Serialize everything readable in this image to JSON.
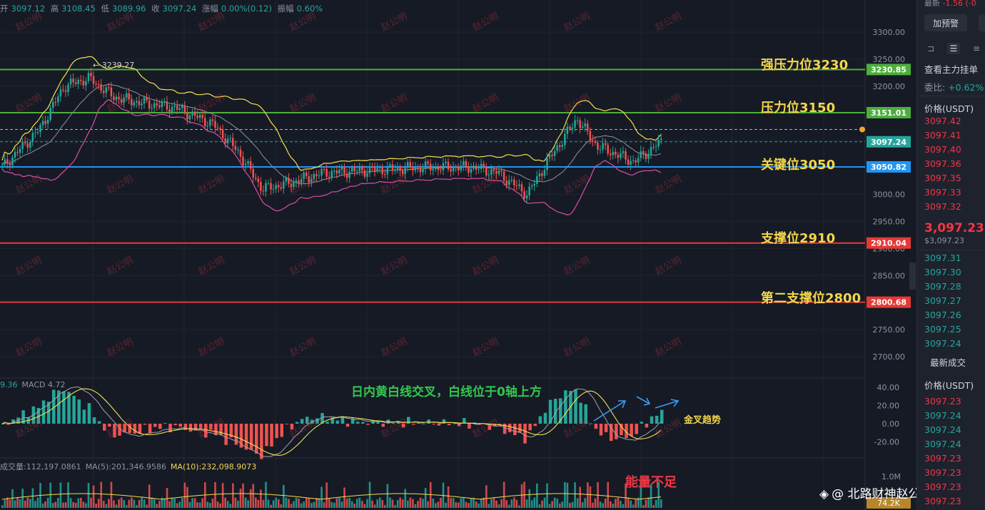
{
  "ohlc_bar": {
    "open_label": "开",
    "open": "3097.12",
    "high_label": "高",
    "high": "3108.45",
    "low_label": "低",
    "low": "3089.96",
    "close_label": "收",
    "close": "3097.24",
    "change_label": "涨幅",
    "change": "0.00%(0.12)",
    "amplitude_label": "振幅",
    "amplitude": "0.60%"
  },
  "price_axis": {
    "ticks": [
      "3300.00",
      "3250.00",
      "3200.00",
      "3150.00",
      "3100.00",
      "3050.00",
      "3000.00",
      "2950.00",
      "2900.00",
      "2850.00",
      "2800.00",
      "2750.00",
      "2700.00"
    ]
  },
  "levels": [
    {
      "label": "强压力位3230",
      "tag": "3230.85",
      "value": 3230.85,
      "color": "#4caf3c"
    },
    {
      "label": "压力位3150",
      "tag": "3151.01",
      "value": 3151.01,
      "color": "#4caf3c"
    },
    {
      "label": "关键位3050",
      "tag": "3050.82",
      "value": 3050.82,
      "color": "#2196f3"
    },
    {
      "label": "支撑位2910",
      "tag": "2910.04",
      "value": 2910.04,
      "color": "#e53935"
    },
    {
      "label": "第二支撑位2800",
      "tag": "2800.68",
      "value": 2800.68,
      "color": "#e53935"
    }
  ],
  "current_price_tag": "3097.24",
  "high_marker": "← 3239.27",
  "macd": {
    "hdr_value": "9.36",
    "hdr_macd": "MACD 4.72",
    "ticks": [
      "40.00",
      "20.00",
      "0.00",
      "-20.00"
    ],
    "annotation_main": "日内黄白线交叉，白线位于0轴上方",
    "annotation_side": "金叉趋势"
  },
  "volume": {
    "hdr_vol": "成交量:112,197.0861",
    "hdr_ma5": "MA(5):201,346.9586",
    "hdr_ma10": "MA(10):232,098.9073",
    "tick_top": "1.0M",
    "tag": "74.2K",
    "annotation": "能量不足"
  },
  "watermark": "赵公明",
  "brand": "@ 北路财神赵公明",
  "panel": {
    "top_text": "最新",
    "top_change": "-1.56 (-0",
    "alert_button": "加预警",
    "orderbook_title": "查看主力挂单",
    "ratio_label": "委比:",
    "ratio_value": "+0.62%",
    "price_header": "价格(USDT)",
    "asks": [
      "3097.42",
      "3097.41",
      "3097.40",
      "3097.36",
      "3097.35",
      "3097.33",
      "3097.32"
    ],
    "last_price": "3,097.23",
    "last_price_sub": "$3,097.23",
    "bids": [
      "3097.31",
      "3097.30",
      "3097.28",
      "3097.27",
      "3097.26",
      "3097.25",
      "3097.24"
    ],
    "trades_title": "最新成交",
    "trades_header": "价格(USDT)",
    "trades": [
      {
        "p": "3097.23",
        "c": "red"
      },
      {
        "p": "3097.24",
        "c": "green"
      },
      {
        "p": "3097.24",
        "c": "green"
      },
      {
        "p": "3097.24",
        "c": "green"
      },
      {
        "p": "3097.23",
        "c": "red"
      },
      {
        "p": "3097.23",
        "c": "red"
      },
      {
        "p": "3097.23",
        "c": "red"
      },
      {
        "p": "3097.23",
        "c": "red"
      }
    ]
  },
  "colors": {
    "up": "#26a69a",
    "down": "#ef5350",
    "boll_upper": "#f4e04d",
    "boll_mid": "#8d93a0",
    "boll_lower": "#d84fa8"
  }
}
